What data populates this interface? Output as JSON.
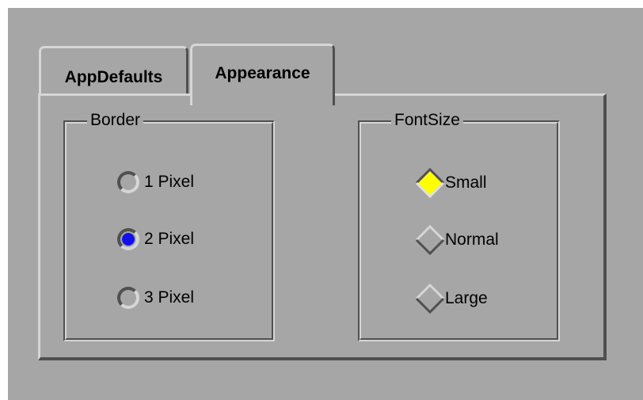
{
  "tabs": [
    {
      "label": "AppDefaults",
      "selected": false
    },
    {
      "label": "Appearance",
      "selected": true
    }
  ],
  "border_group": {
    "title": "Border",
    "options": [
      {
        "label": "1 Pixel",
        "selected": false
      },
      {
        "label": "2 Pixel",
        "selected": true
      },
      {
        "label": "3 Pixel",
        "selected": false
      }
    ]
  },
  "fontsize_group": {
    "title": "FontSize",
    "options": [
      {
        "label": "Small",
        "selected": true
      },
      {
        "label": "Normal",
        "selected": false
      },
      {
        "label": "Large",
        "selected": false
      }
    ]
  },
  "colors": {
    "background": "#a6a6a6",
    "radio_selected": "#1010e8",
    "diamond_selected": "#ffff00"
  }
}
